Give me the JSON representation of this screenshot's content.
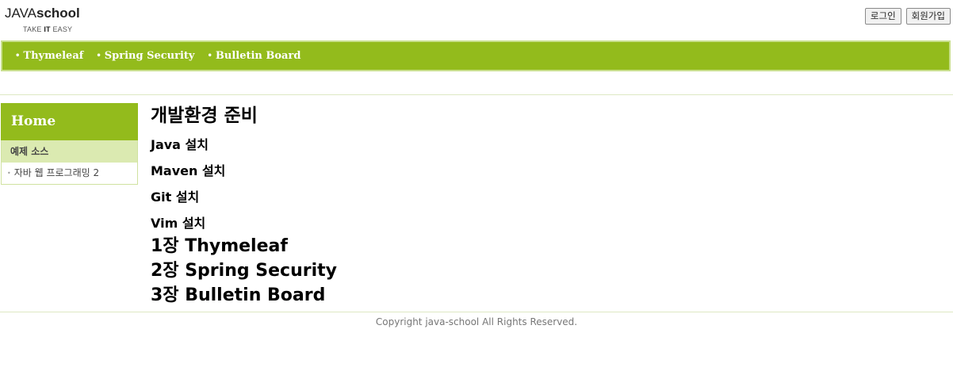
{
  "header": {
    "logo_light": "JAVA",
    "logo_bold": "school",
    "tagline_pre": "TAKE ",
    "tagline_bold": "IT",
    "tagline_post": " EASY",
    "login_label": "로그인",
    "signup_label": "회원가입"
  },
  "nav": {
    "items": [
      {
        "label": "Thymeleaf"
      },
      {
        "label": "Spring Security"
      },
      {
        "label": "Bulletin Board"
      }
    ]
  },
  "sidebar": {
    "home_label": "Home",
    "section_label": "예제 소스",
    "items": [
      {
        "label": "자바 웹 프로그래밍 2"
      }
    ]
  },
  "main": {
    "title": "개발환경 준비",
    "subheadings": [
      "Java 설치",
      "Maven 설치",
      "Git 설치",
      "Vim 설치"
    ],
    "chapters": [
      "1장 Thymeleaf",
      "2장 Spring Security",
      "3장 Bulletin Board"
    ]
  },
  "footer": {
    "copyright": "Copyright java-school All Rights Reserved."
  },
  "colors": {
    "accent": "#93bb1c",
    "accent_light": "#dbeab1"
  }
}
